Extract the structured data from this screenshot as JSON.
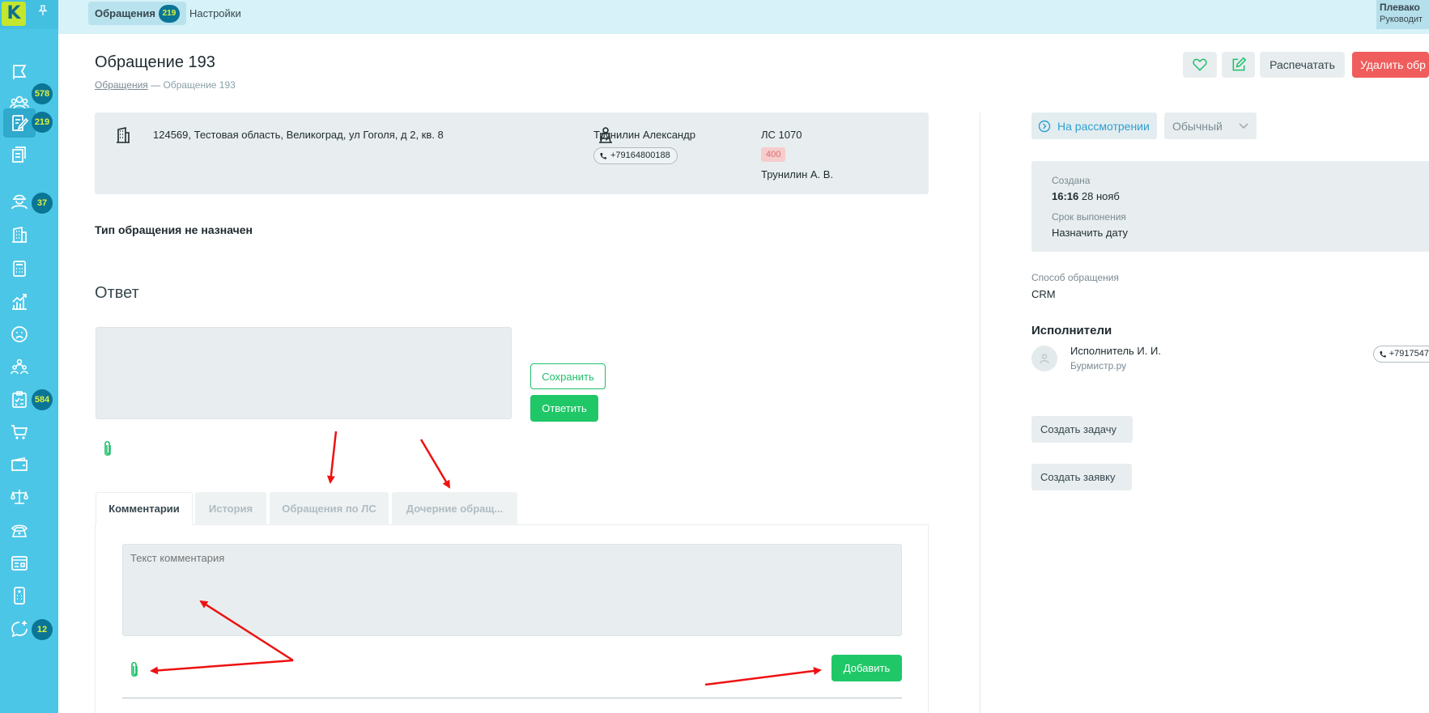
{
  "app": {
    "logo_letter": "K"
  },
  "sidebar": {
    "items": [
      {
        "icon": "flag-icon",
        "badge": ""
      },
      {
        "icon": "users-group-icon",
        "badge": "578"
      },
      {
        "icon": "edit-note-icon",
        "badge": "219",
        "active": true
      },
      {
        "icon": "documents-icon",
        "badge": ""
      },
      {
        "icon": "worker-icon",
        "badge": "37"
      },
      {
        "icon": "building-icon",
        "badge": ""
      },
      {
        "icon": "calculator-icon",
        "badge": ""
      },
      {
        "icon": "chart-icon",
        "badge": ""
      },
      {
        "icon": "sad-face-icon",
        "badge": ""
      },
      {
        "icon": "people-meeting-icon",
        "badge": ""
      },
      {
        "icon": "checklist-icon",
        "badge": "584"
      },
      {
        "icon": "cart-icon",
        "badge": ""
      },
      {
        "icon": "wallet-icon",
        "badge": ""
      },
      {
        "icon": "scales-icon",
        "badge": ""
      },
      {
        "icon": "phone-icon",
        "badge": ""
      },
      {
        "icon": "browser-window-icon",
        "badge": ""
      },
      {
        "icon": "remote-control-icon",
        "badge": ""
      },
      {
        "icon": "chat-add-icon",
        "badge": "12"
      }
    ]
  },
  "topbar": {
    "tabs": [
      {
        "label": "Обращения",
        "badge": "219"
      },
      {
        "label": "Настройки"
      }
    ],
    "user": {
      "name": "Плевако",
      "role": "Руководит"
    }
  },
  "header": {
    "title": "Обращение 193",
    "breadcrumb": {
      "parent": "Обращения",
      "separator": "—",
      "current": "Обращение 193"
    },
    "buttons": {
      "print": "Распечатать",
      "delete": "Удалить обр"
    }
  },
  "info": {
    "address": "124569, Тестовая область, Великоград, ул Гоголя, д 2, кв. 8",
    "owner_name": "Трунилин Александр",
    "owner_phone": "+79164800188",
    "account": "ЛС 1070",
    "debt": "400",
    "account_owner": "Трунилин А. В."
  },
  "main": {
    "type_label": "Тип обращения не назначен",
    "answer_title": "Ответ",
    "save_label": "Сохранить",
    "reply_label": "Ответить",
    "tabs": [
      {
        "label": "Комментарии"
      },
      {
        "label": "История"
      },
      {
        "label": "Обращения по ЛС"
      },
      {
        "label": "Дочерние обращ..."
      }
    ],
    "comment_placeholder": "Текст комментария",
    "add_label": "Добавить"
  },
  "side": {
    "status": "На рассмотрении",
    "priority": "Обычный",
    "created_label": "Создана",
    "created_time": "16:16",
    "created_date": "28 нояб",
    "deadline_label": "Срок выпонения",
    "deadline_value": "Назначить дату",
    "method_label": "Способ обращения",
    "method_value": "CRM",
    "executors_title": "Исполнители",
    "executor_name": "Исполнитель И. И.",
    "executor_org": "Бурмистр.ру",
    "executor_phone": "+7917547",
    "create_task": "Создать задачу",
    "create_request": "Создать заявку"
  },
  "colors": {
    "sidebar": "#4cc6e6",
    "accent_green": "#1fc767",
    "danger": "#f05d5d",
    "badge_bg": "#0b7596",
    "badge_text": "#d8f23f",
    "annotation_red": "#ee1111"
  }
}
